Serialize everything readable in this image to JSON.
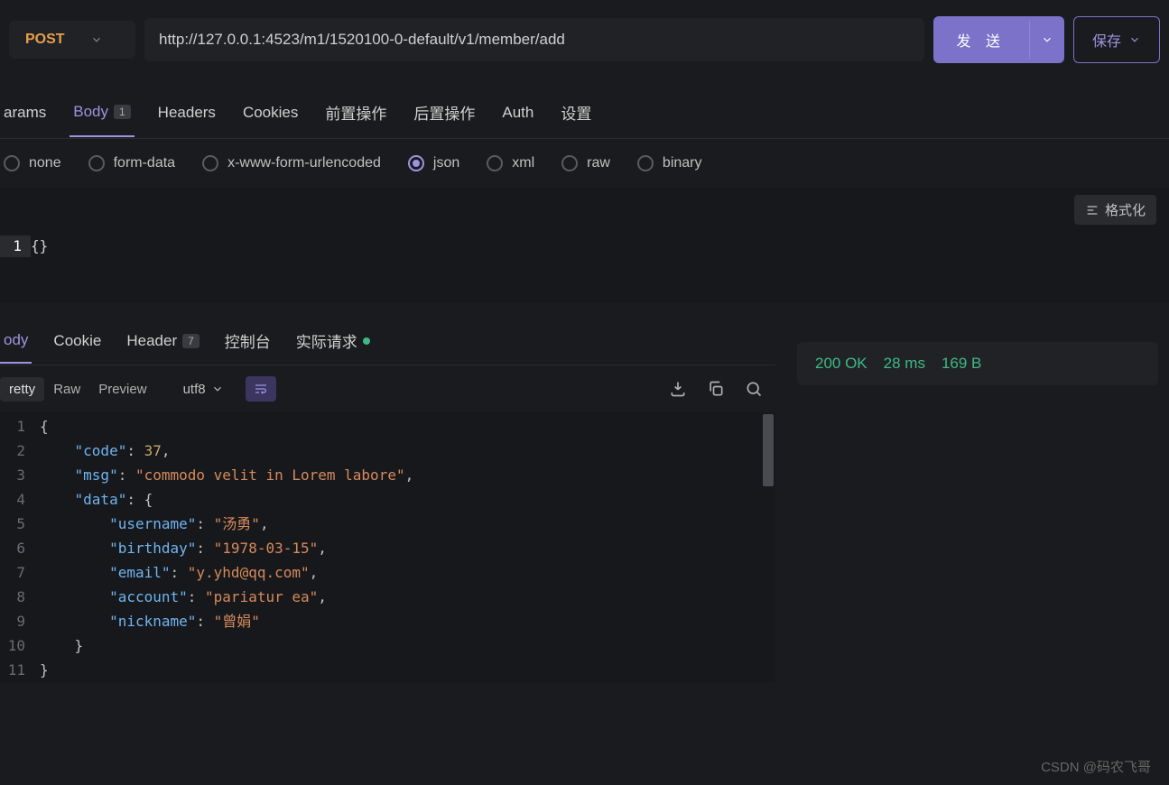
{
  "request": {
    "method": "POST",
    "url": "http://127.0.0.1:4523/m1/1520100-0-default/v1/member/add",
    "send_label": "发 送",
    "save_label": "保存"
  },
  "tabs": {
    "params": "arams",
    "body": "Body",
    "body_badge": "1",
    "headers": "Headers",
    "cookies": "Cookies",
    "pre": "前置操作",
    "post": "后置操作",
    "auth": "Auth",
    "settings": "设置"
  },
  "body_types": {
    "none": "none",
    "form_data": "form-data",
    "urlencoded": "x-www-form-urlencoded",
    "json": "json",
    "xml": "xml",
    "raw": "raw",
    "binary": "binary"
  },
  "format_label": "格式化",
  "request_body": "{}",
  "request_lineno": "1",
  "response_tabs": {
    "body": "ody",
    "cookie": "Cookie",
    "header": "Header",
    "header_badge": "7",
    "console": "控制台",
    "actual": "实际请求"
  },
  "view_modes": {
    "pretty": "retty",
    "raw": "Raw",
    "preview": "Preview"
  },
  "encoding": "utf8",
  "status": {
    "code": "200 OK",
    "time": "28 ms",
    "size": "169 B"
  },
  "response_json": {
    "code": 37,
    "msg": "commodo velit in Lorem labore",
    "data": {
      "username": "汤勇",
      "birthday": "1978-03-15",
      "email": "y.yhd@qq.com",
      "account": "pariatur ea",
      "nickname": "曾娟"
    }
  },
  "response_lines": [
    {
      "n": "1",
      "i": 0,
      "tokens": [
        [
          "punc",
          "{"
        ]
      ]
    },
    {
      "n": "2",
      "i": 1,
      "tokens": [
        [
          "key",
          "\"code\""
        ],
        [
          "punc",
          ": "
        ],
        [
          "num",
          "37"
        ],
        [
          "punc",
          ","
        ]
      ]
    },
    {
      "n": "3",
      "i": 1,
      "tokens": [
        [
          "key",
          "\"msg\""
        ],
        [
          "punc",
          ": "
        ],
        [
          "str",
          "\"commodo velit in Lorem labore\""
        ],
        [
          "punc",
          ","
        ]
      ]
    },
    {
      "n": "4",
      "i": 1,
      "tokens": [
        [
          "key",
          "\"data\""
        ],
        [
          "punc",
          ": {"
        ]
      ]
    },
    {
      "n": "5",
      "i": 2,
      "tokens": [
        [
          "key",
          "\"username\""
        ],
        [
          "punc",
          ": "
        ],
        [
          "str",
          "\"汤勇\""
        ],
        [
          "punc",
          ","
        ]
      ]
    },
    {
      "n": "6",
      "i": 2,
      "tokens": [
        [
          "key",
          "\"birthday\""
        ],
        [
          "punc",
          ": "
        ],
        [
          "str",
          "\"1978-03-15\""
        ],
        [
          "punc",
          ","
        ]
      ]
    },
    {
      "n": "7",
      "i": 2,
      "tokens": [
        [
          "key",
          "\"email\""
        ],
        [
          "punc",
          ": "
        ],
        [
          "str",
          "\"y.yhd@qq.com\""
        ],
        [
          "punc",
          ","
        ]
      ]
    },
    {
      "n": "8",
      "i": 2,
      "tokens": [
        [
          "key",
          "\"account\""
        ],
        [
          "punc",
          ": "
        ],
        [
          "str",
          "\"pariatur ea\""
        ],
        [
          "punc",
          ","
        ]
      ]
    },
    {
      "n": "9",
      "i": 2,
      "tokens": [
        [
          "key",
          "\"nickname\""
        ],
        [
          "punc",
          ": "
        ],
        [
          "str",
          "\"曾娟\""
        ]
      ]
    },
    {
      "n": "10",
      "i": 1,
      "tokens": [
        [
          "punc",
          "}"
        ]
      ]
    },
    {
      "n": "11",
      "i": 0,
      "tokens": [
        [
          "punc",
          "}"
        ]
      ]
    }
  ],
  "watermark": "CSDN @码农飞哥"
}
